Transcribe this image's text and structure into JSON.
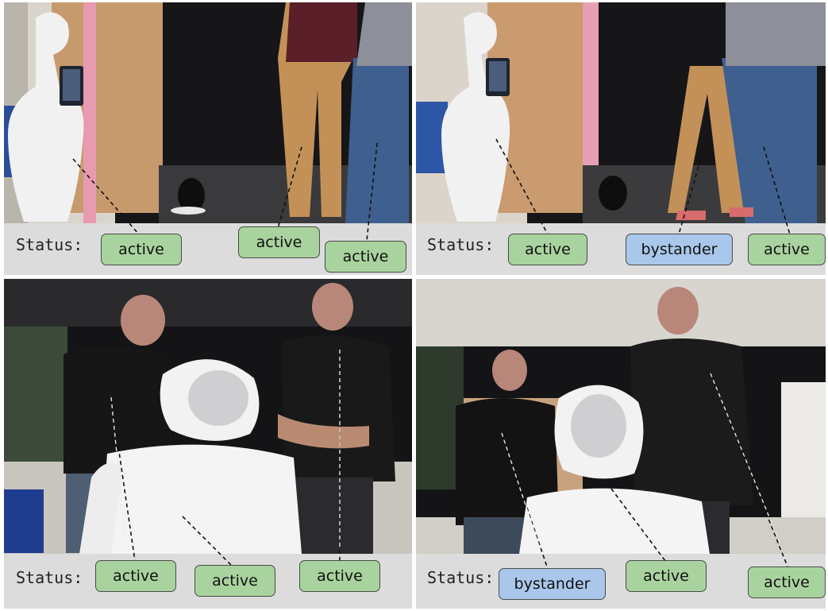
{
  "status_label": "Status:",
  "panels": [
    {
      "tags": [
        {
          "state": "active",
          "text": "active"
        },
        {
          "state": "active",
          "text": "active"
        },
        {
          "state": "active",
          "text": "active"
        }
      ]
    },
    {
      "tags": [
        {
          "state": "active",
          "text": "active"
        },
        {
          "state": "bystander",
          "text": "bystander"
        },
        {
          "state": "active",
          "text": "active"
        }
      ]
    },
    {
      "tags": [
        {
          "state": "active",
          "text": "active"
        },
        {
          "state": "active",
          "text": "active"
        },
        {
          "state": "active",
          "text": "active"
        }
      ]
    },
    {
      "tags": [
        {
          "state": "bystander",
          "text": "bystander"
        },
        {
          "state": "active",
          "text": "active"
        },
        {
          "state": "active",
          "text": "active"
        }
      ]
    }
  ],
  "colors": {
    "active": "#a9d39e",
    "bystander": "#a9c7ea",
    "status_bar": "#dcdcdc"
  }
}
